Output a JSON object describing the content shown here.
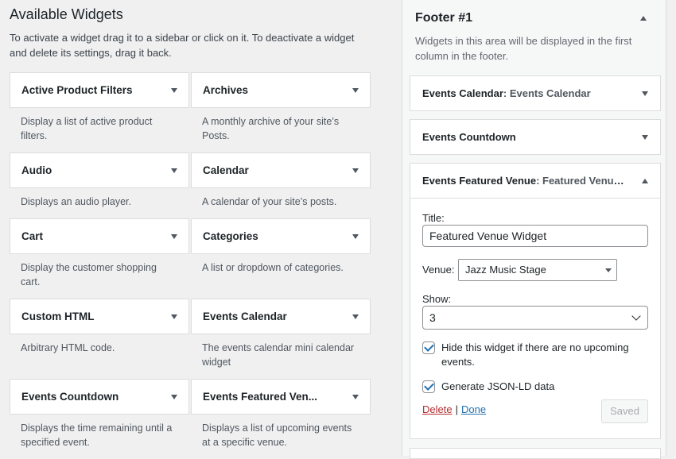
{
  "available": {
    "title": "Available Widgets",
    "description": "To activate a widget drag it to a sidebar or click on it. To deactivate a widget and delete its settings, drag it back.",
    "widgets": [
      {
        "name": "Active Product Filters",
        "desc": "Display a list of active product filters."
      },
      {
        "name": "Archives",
        "desc": "A monthly archive of your site’s Posts."
      },
      {
        "name": "Audio",
        "desc": "Displays an audio player."
      },
      {
        "name": "Calendar",
        "desc": "A calendar of your site’s posts."
      },
      {
        "name": "Cart",
        "desc": "Display the customer shopping cart."
      },
      {
        "name": "Categories",
        "desc": "A list or dropdown of categories."
      },
      {
        "name": "Custom HTML",
        "desc": "Arbitrary HTML code."
      },
      {
        "name": "Events Calendar",
        "desc": "The events calendar mini calendar widget"
      },
      {
        "name": "Events Countdown",
        "desc": "Displays the time remaining until a specified event."
      },
      {
        "name": "Events Featured Ven...",
        "desc": "Displays a list of upcoming events at a specific venue."
      }
    ]
  },
  "sidebar": {
    "title": "Footer #1",
    "description": "Widgets in this area will be displayed in the first column in the footer.",
    "widgets": [
      {
        "name": "Events Calendar",
        "instance": ": Events Calendar"
      },
      {
        "name": "Events Countdown",
        "instance": ""
      },
      {
        "name": "Events Featured Venue",
        "instance": ": Featured Venue..."
      }
    ],
    "form": {
      "title_label": "Title:",
      "title_value": "Featured Venue Widget",
      "venue_label": "Venue:",
      "venue_value": "Jazz Music Stage",
      "show_label": "Show:",
      "show_value": "3",
      "hide_label": "Hide this widget if there are no upcoming events.",
      "hide_checked": true,
      "jsonld_label": "Generate JSON-LD data",
      "jsonld_checked": true,
      "delete_label": "Delete",
      "separator": "|",
      "done_label": "Done",
      "saved_label": "Saved"
    }
  }
}
